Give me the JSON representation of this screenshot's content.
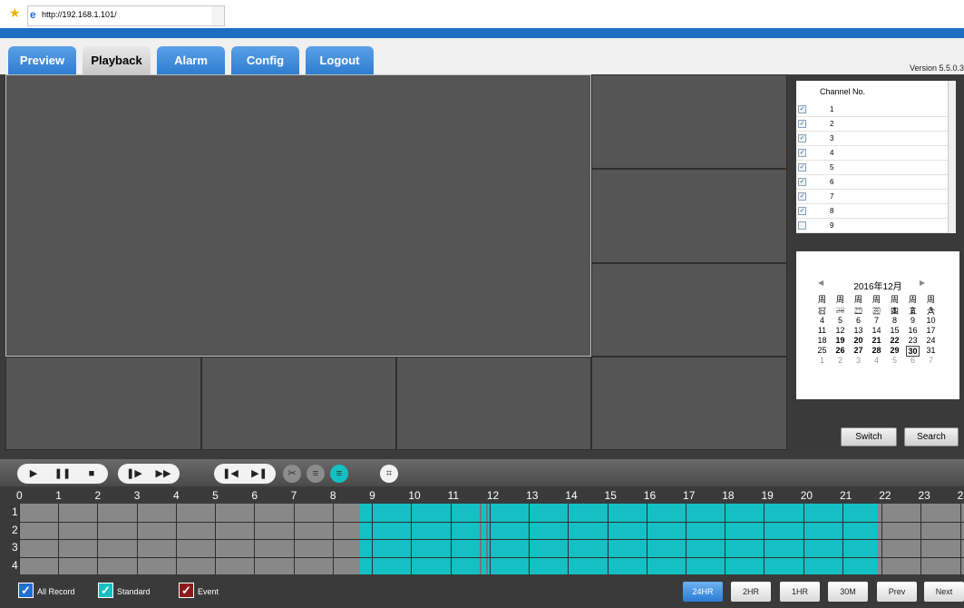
{
  "browser": {
    "url": "http://192.168.1.101/"
  },
  "nav": {
    "tabs": [
      "Preview",
      "Playback",
      "Alarm",
      "Config",
      "Logout"
    ],
    "active": "Playback",
    "version": "Version 5.5.0.3"
  },
  "channels": {
    "header": "Channel No.",
    "items": [
      {
        "no": "1",
        "checked": true
      },
      {
        "no": "2",
        "checked": true
      },
      {
        "no": "3",
        "checked": true
      },
      {
        "no": "4",
        "checked": true
      },
      {
        "no": "5",
        "checked": true
      },
      {
        "no": "6",
        "checked": true
      },
      {
        "no": "7",
        "checked": true
      },
      {
        "no": "8",
        "checked": true
      },
      {
        "no": "9",
        "checked": false
      }
    ]
  },
  "calendar": {
    "title": "2016年12月",
    "weekdays": [
      "周日",
      "周一",
      "周二",
      "周三",
      "周四",
      "周五",
      "周六"
    ],
    "weeks": [
      [
        "27",
        "28",
        "29",
        "30",
        "1",
        "2",
        "3"
      ],
      [
        "4",
        "5",
        "6",
        "7",
        "8",
        "9",
        "10"
      ],
      [
        "11",
        "12",
        "13",
        "14",
        "15",
        "16",
        "17"
      ],
      [
        "18",
        "19",
        "20",
        "21",
        "22",
        "23",
        "24"
      ],
      [
        "25",
        "26",
        "27",
        "28",
        "29",
        "30",
        "31"
      ],
      [
        "1",
        "2",
        "3",
        "4",
        "5",
        "6",
        "7"
      ]
    ],
    "selected": "30",
    "record_days": [
      "19",
      "20",
      "21",
      "22",
      "26",
      "27",
      "28",
      "29",
      "30"
    ]
  },
  "buttons": {
    "switch": "Switch",
    "search": "Search"
  },
  "timeline": {
    "hours": [
      "0",
      "1",
      "2",
      "3",
      "4",
      "5",
      "6",
      "7",
      "8",
      "9",
      "10",
      "11",
      "12",
      "13",
      "14",
      "15",
      "16",
      "17",
      "18",
      "19",
      "20",
      "21",
      "22",
      "23",
      "24"
    ],
    "rows": [
      "1",
      "2",
      "3",
      "4"
    ],
    "record_start_hour": 8.7,
    "record_end_hour": 21.9,
    "record_color": "#14c0c3"
  },
  "legend": {
    "all": "All Record",
    "standard": "Standard",
    "event": "Event",
    "all_color": "#1f6fd1",
    "standard_color": "#14c0c3",
    "event_color": "#8b1a1a"
  },
  "zoom": {
    "items": [
      "24HR",
      "2HR",
      "1HR",
      "30M",
      "Prev",
      "Next"
    ],
    "active": "24HR"
  }
}
